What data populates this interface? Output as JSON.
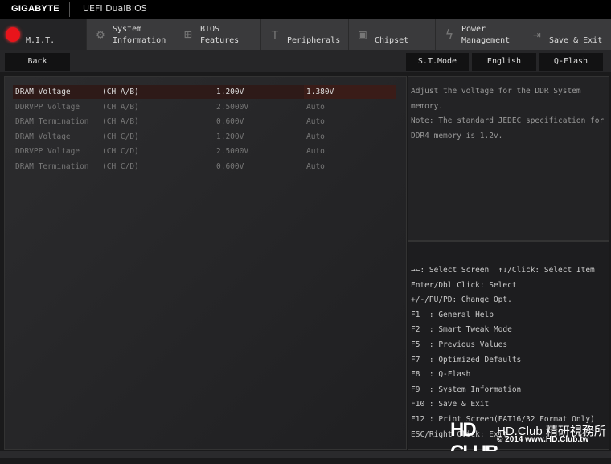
{
  "header": {
    "brand": "GIGABYTE",
    "product": "UEFI DualBIOS"
  },
  "tabs": [
    {
      "label": "M.I.T.",
      "icon": "mit-red-dot-icon",
      "active": true
    },
    {
      "label": "System\nInformation",
      "icon": "gear-icon"
    },
    {
      "label": "BIOS\nFeatures",
      "icon": "bios-plus-icon"
    },
    {
      "label": "Peripherals",
      "icon": "peripherals-icon"
    },
    {
      "label": "Chipset",
      "icon": "chip-icon"
    },
    {
      "label": "Power\nManagement",
      "icon": "power-bolt-icon"
    },
    {
      "label": "Save & Exit",
      "icon": "exit-door-icon"
    }
  ],
  "subbar": {
    "back": "Back",
    "st_mode": "S.T.Mode",
    "language": "English",
    "qflash": "Q-Flash"
  },
  "settings": [
    {
      "name": "DRAM Voltage",
      "channel": "(CH A/B)",
      "current": "1.200V",
      "value": "1.380V",
      "selected": true
    },
    {
      "name": "DDRVPP Voltage",
      "channel": "(CH A/B)",
      "current": "2.5000V",
      "value": "Auto"
    },
    {
      "name": "DRAM Termination",
      "channel": "(CH A/B)",
      "current": "0.600V",
      "value": "Auto"
    },
    {
      "name": "DRAM Voltage",
      "channel": "(CH C/D)",
      "current": "1.200V",
      "value": "Auto"
    },
    {
      "name": "DDRVPP Voltage",
      "channel": "(CH C/D)",
      "current": "2.5000V",
      "value": "Auto"
    },
    {
      "name": "DRAM Termination",
      "channel": "(CH C/D)",
      "current": "0.600V",
      "value": "Auto"
    }
  ],
  "help": {
    "text": "Adjust the voltage for the DDR System memory.",
    "note": "Note: The standard JEDEC specification for DDR4 memory is 1.2v."
  },
  "keys": [
    "→←: Select Screen  ↑↓/Click: Select Item",
    "Enter/Dbl Click: Select",
    "+/-/PU/PD: Change Opt.",
    "F1  : General Help",
    "F2  : Smart Tweak Mode",
    "F5  : Previous Values",
    "F7  : Optimized Defaults",
    "F8  : Q-Flash",
    "F9  : System Information",
    "F10 : Save & Exit",
    "F12 : Print Screen(FAT16/32 Format Only)",
    "ESC/Right Click: Exit"
  ],
  "watermark": {
    "logo": "HD CLUB",
    "name": "HD.Club 精研視務所",
    "line2": "© 2014  www.HD.Club.tw"
  }
}
